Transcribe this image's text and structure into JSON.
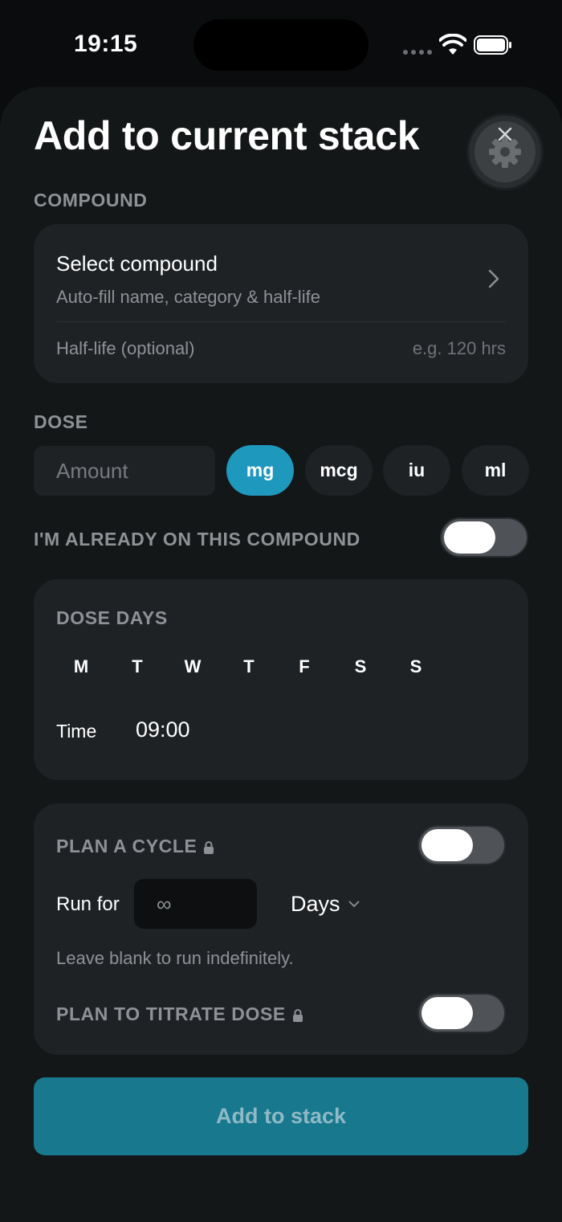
{
  "status_bar": {
    "time": "19:15"
  },
  "header": {
    "title": "Add to current stack"
  },
  "compound": {
    "section_label": "COMPOUND",
    "select_title": "Select compound",
    "select_subtitle": "Auto-fill name, category & half-life",
    "half_life_label": "Half-life (optional)",
    "half_life_placeholder": "e.g. 120 hrs"
  },
  "dose": {
    "section_label": "DOSE",
    "amount_placeholder": "Amount",
    "units": [
      "mg",
      "mcg",
      "iu",
      "ml"
    ],
    "selected_unit": "mg"
  },
  "already_on": {
    "label": "I'M ALREADY ON THIS COMPOUND",
    "enabled": false
  },
  "dose_days": {
    "label": "DOSE DAYS",
    "days": [
      "M",
      "T",
      "W",
      "T",
      "F",
      "S",
      "S"
    ],
    "time_label": "Time",
    "time_value": "09:00"
  },
  "cycle": {
    "label": "PLAN A CYCLE",
    "enabled": false,
    "run_for_label": "Run for",
    "run_for_value": "∞",
    "period_unit": "Days",
    "hint": "Leave blank to run indefinitely.",
    "titrate_label": "PLAN TO TITRATE DOSE",
    "titrate_enabled": false
  },
  "add_button_label": "Add to stack",
  "colors": {
    "accent": "#1f98bd",
    "primary_button": "#17788e",
    "card": "#1f2225"
  }
}
